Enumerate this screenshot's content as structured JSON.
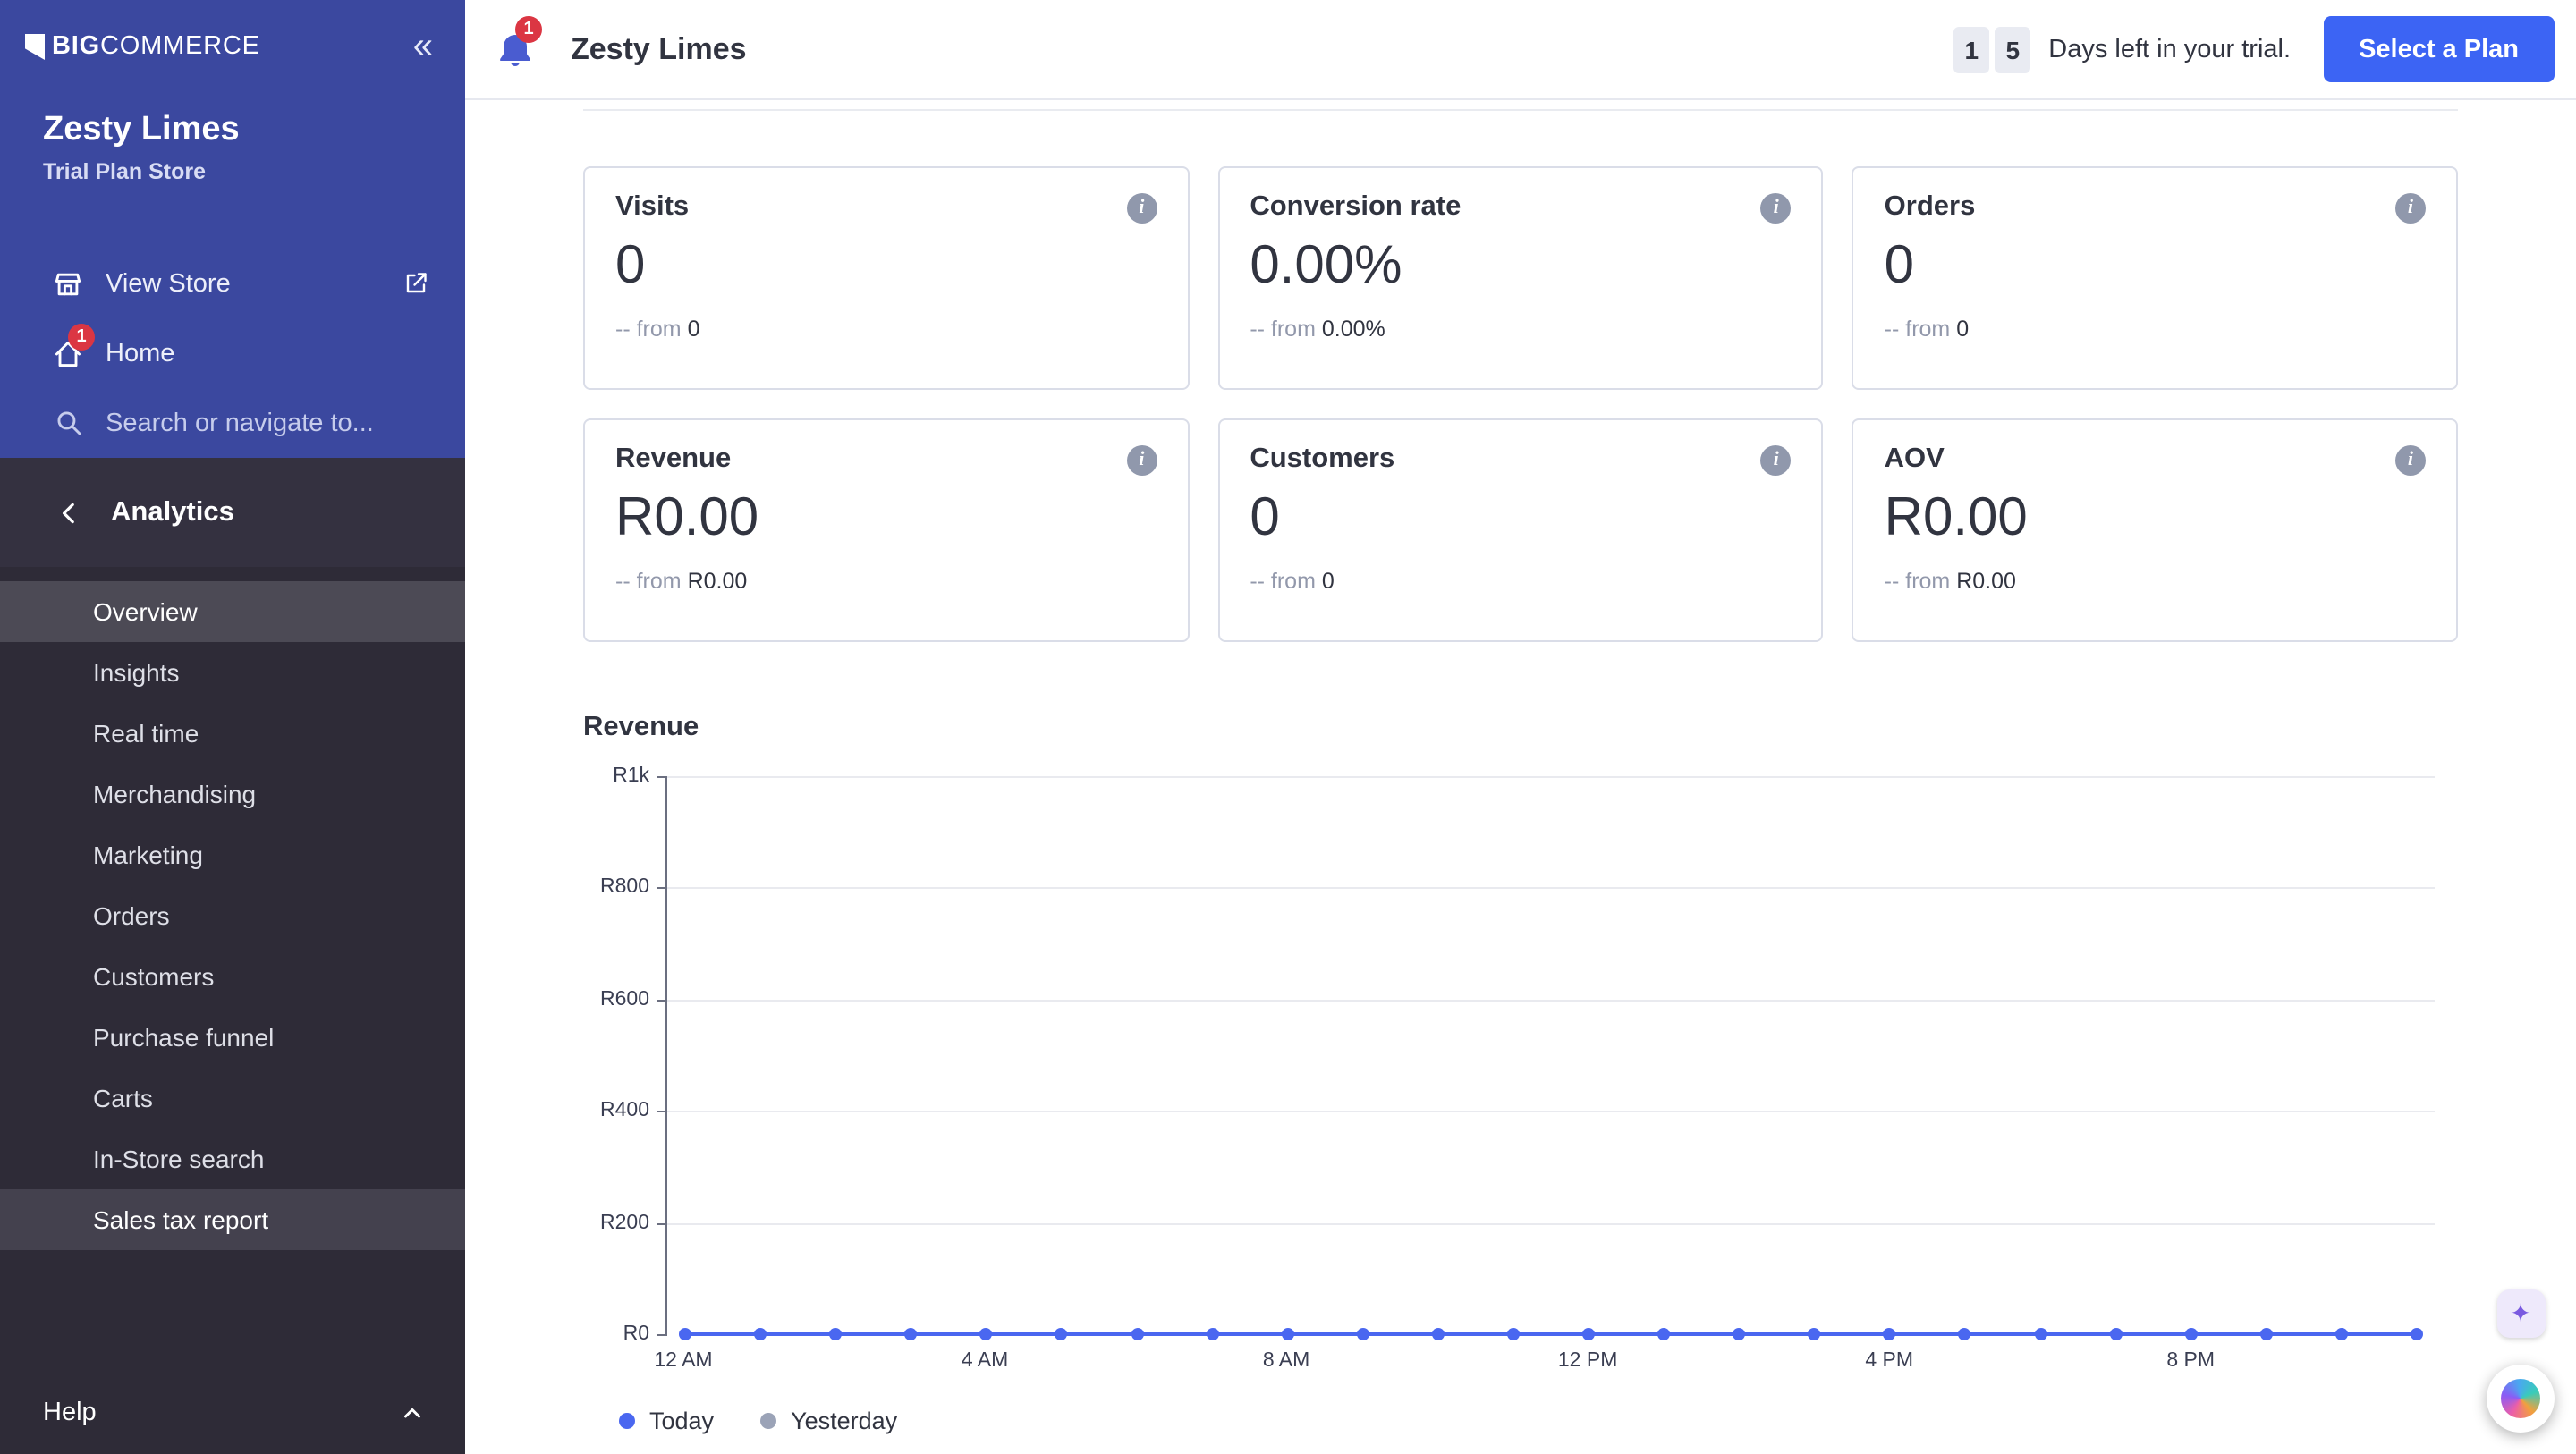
{
  "colors": {
    "accent": "#3C64F4",
    "badge_red": "#DB3643",
    "sidebar_blue": "#3B489F",
    "sidebar_dark": "#2E2B37"
  },
  "icons": {
    "collapse": "«",
    "info": "i",
    "sparkle": "✦"
  },
  "sidebar": {
    "logo_bold": "BIG",
    "logo_rest": "COMMERCE",
    "store_name": "Zesty Limes",
    "store_plan": "Trial Plan Store",
    "view_store_label": "View Store",
    "home_label": "Home",
    "home_badge": "1",
    "search_placeholder": "Search or navigate to...",
    "section_title": "Analytics",
    "items": [
      "Overview",
      "Insights",
      "Real time",
      "Merchandising",
      "Marketing",
      "Orders",
      "Customers",
      "Purchase funnel",
      "Carts",
      "In-Store search",
      "Sales tax report"
    ],
    "active_item": "Overview",
    "highlighted_item": "Sales tax report",
    "help_label": "Help"
  },
  "header": {
    "notification_badge": "1",
    "title": "Zesty Limes",
    "trial_digit_1": "1",
    "trial_digit_2": "5",
    "trial_text": "Days left in your trial.",
    "cta_label": "Select a Plan"
  },
  "stats": [
    {
      "title": "Visits",
      "value": "0",
      "delta_prefix": "-- from",
      "delta_value": "0"
    },
    {
      "title": "Conversion rate",
      "value": "0.00%",
      "delta_prefix": "-- from",
      "delta_value": "0.00%"
    },
    {
      "title": "Orders",
      "value": "0",
      "delta_prefix": "-- from",
      "delta_value": "0"
    },
    {
      "title": "Revenue",
      "value": "R0.00",
      "delta_prefix": "-- from",
      "delta_value": "R0.00"
    },
    {
      "title": "Customers",
      "value": "0",
      "delta_prefix": "-- from",
      "delta_value": "0"
    },
    {
      "title": "AOV",
      "value": "R0.00",
      "delta_prefix": "-- from",
      "delta_value": "R0.00"
    }
  ],
  "chart_data": {
    "type": "line",
    "title": "Revenue",
    "x_count": 24,
    "x_tick_labels": [
      "12 AM",
      "4 AM",
      "8 AM",
      "12 PM",
      "4 PM",
      "8 PM"
    ],
    "x_tick_positions": [
      0,
      4,
      8,
      12,
      16,
      20
    ],
    "y_tick_labels": [
      "R1k",
      "R800",
      "R600",
      "R400",
      "R200",
      "R0"
    ],
    "ylim": [
      0,
      1000
    ],
    "grid": true,
    "legend_position": "bottom-left",
    "series": [
      {
        "name": "Today",
        "color": "#4A67F0",
        "values": [
          0,
          0,
          0,
          0,
          0,
          0,
          0,
          0,
          0,
          0,
          0,
          0,
          0,
          0,
          0,
          0,
          0,
          0,
          0,
          0,
          0,
          0,
          0,
          0
        ]
      },
      {
        "name": "Yesterday",
        "color": "#9BA3B7",
        "values": []
      }
    ]
  }
}
